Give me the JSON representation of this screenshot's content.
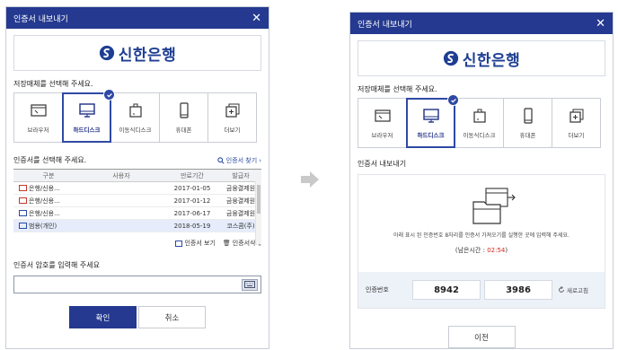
{
  "left": {
    "title": "인증서 내보내기",
    "logo_text": "신한은행",
    "media_prompt": "저장매체를 선택해 주세요.",
    "media": [
      {
        "label": "브라우저",
        "icon": "browser-icon"
      },
      {
        "label": "하드디스크",
        "icon": "monitor-icon"
      },
      {
        "label": "이동식디스크",
        "icon": "usb-icon"
      },
      {
        "label": "휴대폰",
        "icon": "phone-icon"
      },
      {
        "label": "더보기",
        "icon": "more-icon"
      }
    ],
    "selected_media": "하드디스크",
    "cert_prompt": "인증서를 선택해 주세요.",
    "cert_search": "인증서 찾기",
    "columns": [
      "구분",
      "사용자",
      "만료기간",
      "발급자"
    ],
    "rows": [
      {
        "type": "은행/신용...",
        "user": "",
        "expire": "2017-01-05",
        "issuer": "금융결제원"
      },
      {
        "type": "은행/신용...",
        "user": "",
        "expire": "2017-01-12",
        "issuer": "금융결제원"
      },
      {
        "type": "은행/신용...",
        "user": "",
        "expire": "2017-06-17",
        "issuer": "금융결제원"
      },
      {
        "type": "범용(개인)",
        "user": "",
        "expire": "2018-05-19",
        "issuer": "코스콤(주)"
      }
    ],
    "view_cert": "인증서 보기",
    "delete_cert": "인증서삭제",
    "pw_prompt": "인증서 암호를 입력해 주세요",
    "ok": "확인",
    "cancel": "취소"
  },
  "right": {
    "title": "인증서 내보내기",
    "logo_text": "신한은행",
    "media_prompt": "저장매체를 선택해 주세요.",
    "media": [
      {
        "label": "브라우저"
      },
      {
        "label": "하드디스크"
      },
      {
        "label": "이동식디스크"
      },
      {
        "label": "휴대폰"
      },
      {
        "label": "더보기"
      }
    ],
    "export_title": "인증서 내보내기",
    "desc": "아래 표시 된 인증번호 8자리를 인증서 가져오기를 실행한 곳에 입력해 주세요.",
    "timer_label": "(남은시간 : ",
    "timer_value": "02:54",
    "timer_end": ")",
    "code_label": "인증번호",
    "code1": "8942",
    "code2": "3986",
    "refresh": "새로고침",
    "prev": "이전"
  },
  "colors": {
    "brand_navy": "#24398f",
    "accent_blue": "#2f49a4",
    "timer_red": "#d0281b"
  }
}
